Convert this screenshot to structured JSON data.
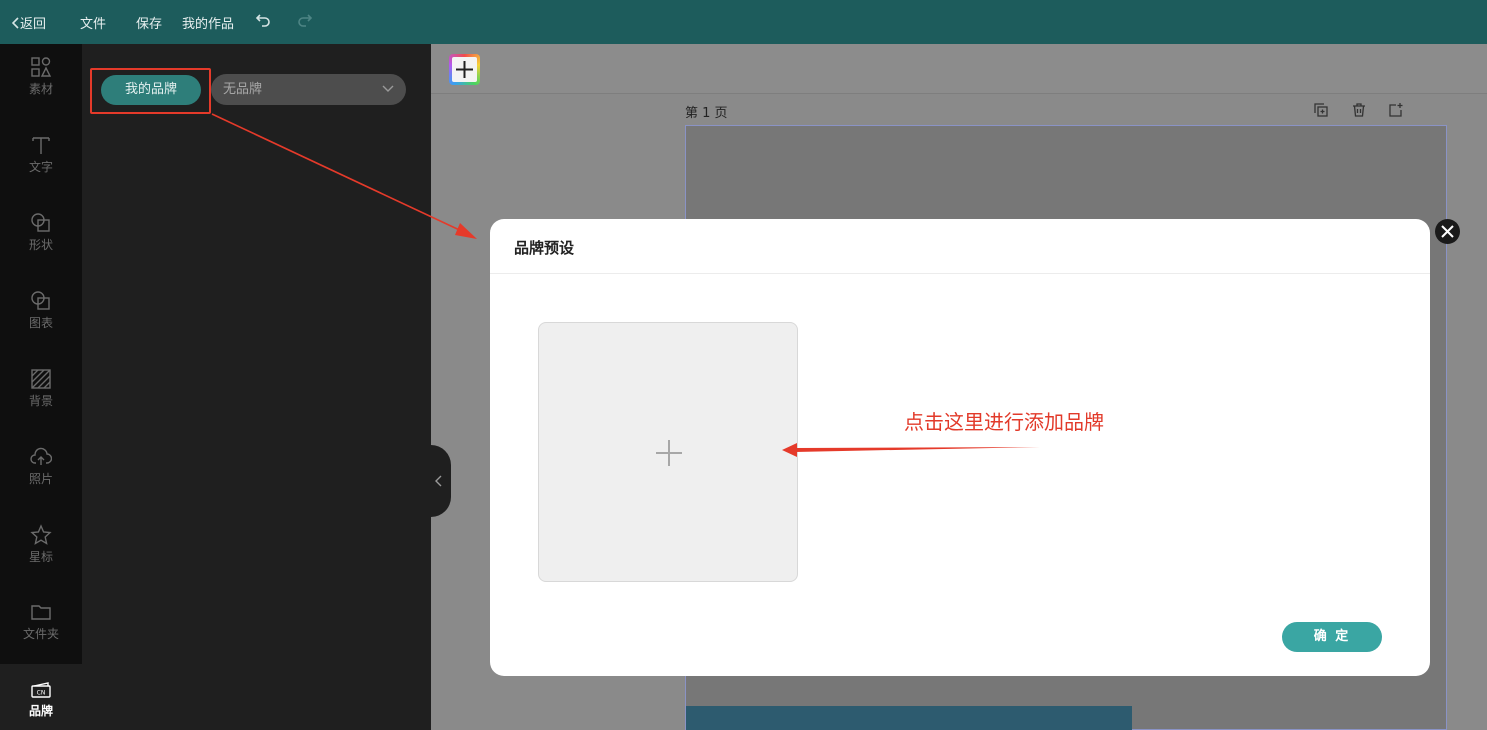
{
  "topbar": {
    "back_label": "返回",
    "file_label": "文件",
    "save_label": "保存",
    "works_label": "我的作品"
  },
  "rail": {
    "items": [
      {
        "label": "素材",
        "icon": "shapes-icon"
      },
      {
        "label": "文字",
        "icon": "text-icon"
      },
      {
        "label": "形状",
        "icon": "shape-icon"
      },
      {
        "label": "图表",
        "icon": "chart-icon"
      },
      {
        "label": "背景",
        "icon": "background-icon"
      },
      {
        "label": "照片",
        "icon": "upload-cloud-icon"
      },
      {
        "label": "星标",
        "icon": "star-icon"
      },
      {
        "label": "文件夹",
        "icon": "folder-icon"
      },
      {
        "label": "品牌",
        "icon": "brand-icon"
      }
    ]
  },
  "panel": {
    "my_brand_label": "我的品牌",
    "brand_select_value": "无品牌"
  },
  "canvas": {
    "page_label": "第 1 页"
  },
  "modal": {
    "title": "品牌预设",
    "hint": "点击这里进行添加品牌",
    "confirm_label": "确 定"
  },
  "colors": {
    "topbar": "#1d5c5c",
    "accent": "#3aa6a3",
    "annotation": "#e53a2a"
  }
}
